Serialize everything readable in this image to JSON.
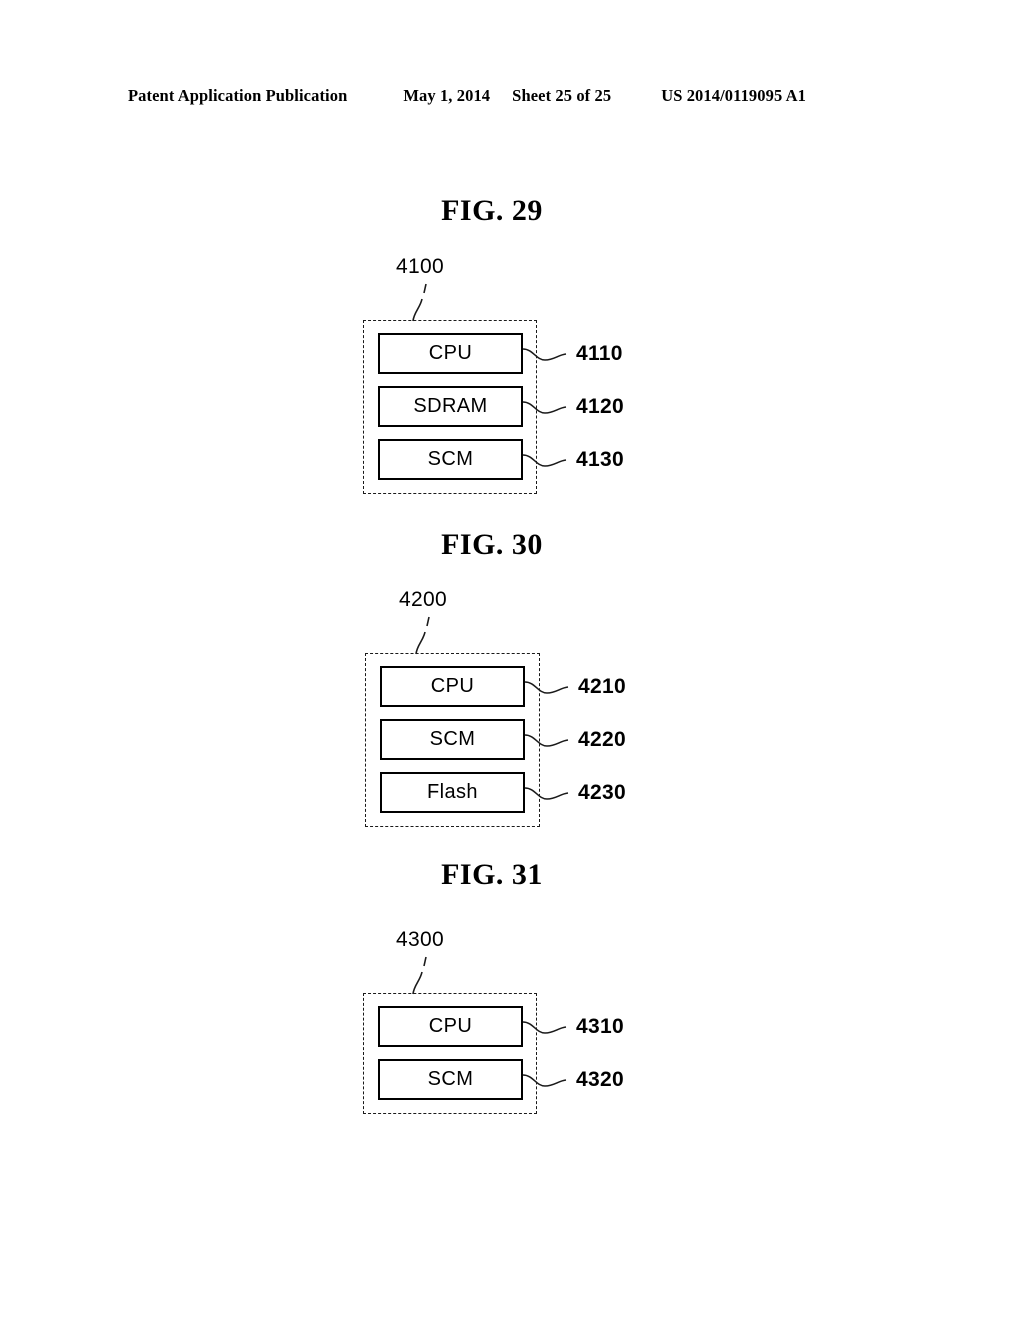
{
  "header": {
    "publication": "Patent Application Publication",
    "date": "May 1, 2014",
    "sheet": "Sheet 25 of 25",
    "patent_number": "US 2014/0119095 A1"
  },
  "figures": [
    {
      "title": "FIG. 29",
      "container_ref": "4100",
      "blocks": [
        {
          "label": "CPU",
          "ref": "4110"
        },
        {
          "label": "SDRAM",
          "ref": "4120"
        },
        {
          "label": "SCM",
          "ref": "4130"
        }
      ]
    },
    {
      "title": "FIG. 30",
      "container_ref": "4200",
      "blocks": [
        {
          "label": "CPU",
          "ref": "4210"
        },
        {
          "label": "SCM",
          "ref": "4220"
        },
        {
          "label": "Flash",
          "ref": "4230"
        }
      ]
    },
    {
      "title": "FIG. 31",
      "container_ref": "4300",
      "blocks": [
        {
          "label": "CPU",
          "ref": "4310"
        },
        {
          "label": "SCM",
          "ref": "4320"
        }
      ]
    }
  ]
}
